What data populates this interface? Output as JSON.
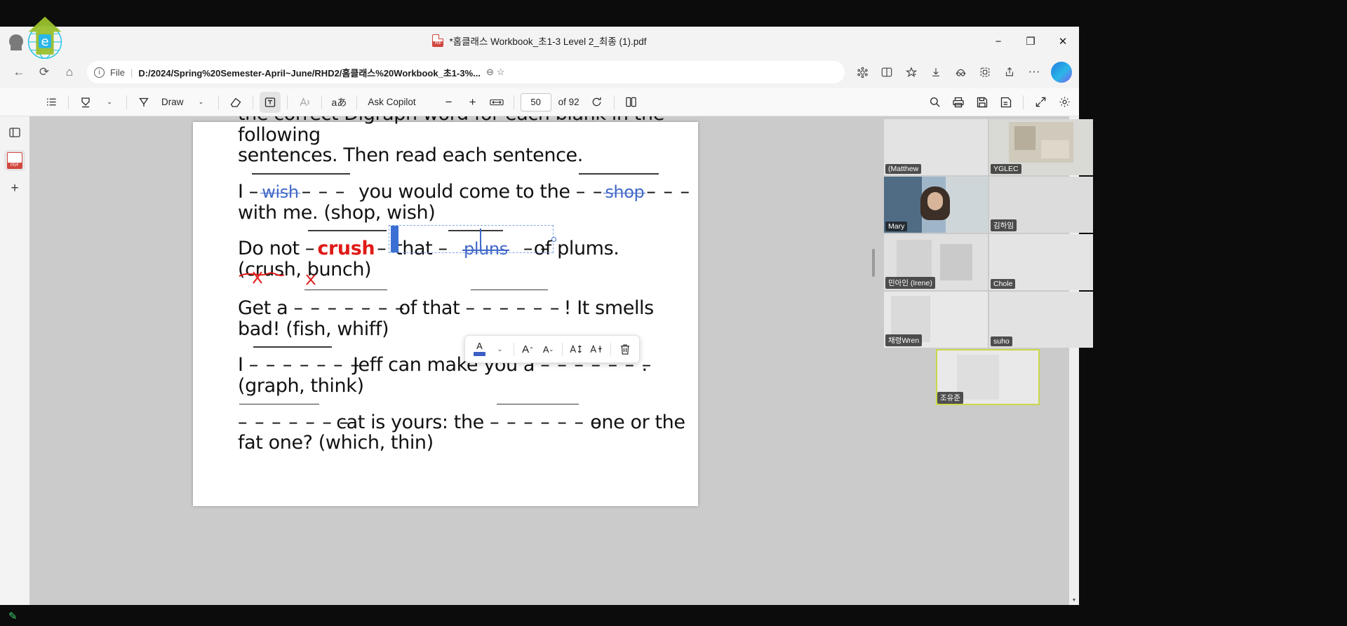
{
  "window": {
    "title": "*홈클래스 Workbook_초1-3 Level 2_최종 (1).pdf",
    "minimize": "−",
    "restore": "❐",
    "close": "✕"
  },
  "navbar": {
    "back": "←",
    "refresh": "⟳",
    "home": "⌂",
    "info_icon": "ⓘ",
    "file_label": "File",
    "separator": "|",
    "url": "D:/2024/Spring%20Semester-April~June/RHD2/홈클래스%20Workbook_초1-3%...",
    "zoom_out_icon": "⊖",
    "favorite_icon": "☆",
    "right_icons": [
      "collections-icon",
      "split-screen-icon",
      "favorites-icon",
      "downloads-icon",
      "extensions-icon",
      "browser-essentials-icon",
      "share-icon",
      "settings-more-icon"
    ],
    "copilot_label": "copilot-icon"
  },
  "pdf_toolbar": {
    "toc_icon": "☰",
    "highlight_icon": "✎",
    "highlight_chevron": "⌄",
    "draw_icon": "▽",
    "draw_label": "Draw",
    "draw_chevron": "⌄",
    "eraser_icon": "◇",
    "text_icon": "T",
    "read_aloud_icon": "A",
    "translate_icon": "aあ",
    "ask_copilot_label": "Ask Copilot",
    "zoom_out": "−",
    "zoom_in": "+",
    "fit_icon": "↔",
    "page_current": "50",
    "page_of": "of 92",
    "rotate_icon": "⟳",
    "layout_icon": "▯",
    "search_icon": "⌕",
    "print_icon": "⎙",
    "save_icon": "💾",
    "save_as_icon": "🖫",
    "fullscreen_icon": "⤢",
    "settings_icon": "⚙"
  },
  "left_rail": {
    "items": [
      {
        "name": "sidebar-toggle-icon",
        "glyph": "▤"
      },
      {
        "name": "pdf-tool-icon",
        "glyph": "PDF"
      },
      {
        "name": "add-icon",
        "glyph": "+"
      }
    ]
  },
  "format_toolbar": {
    "font_color_letter": "A",
    "font_color_hex": "#3b5fc4",
    "font_color_chevron": "⌄",
    "grow_font": "A",
    "shrink_font": "A",
    "line_spacing_increase": "A",
    "line_spacing_decrease": "A",
    "delete_icon": "🗑"
  },
  "document": {
    "intro_line1": "the correct Digraph word for each blank in the following",
    "intro_line2": "sentences. Then read each sentence.",
    "items": [
      {
        "id": "q1",
        "prefix": "I",
        "answer1": "wish",
        "middle": "you would come to the",
        "answer2": "shop",
        "suffix_line": "with me. (shop, wish)"
      },
      {
        "id": "q2",
        "prefix": "Do not",
        "answer1": "crush",
        "middle": "that",
        "answer2": "pluns",
        "suffix": "of plums.",
        "suffix_line": "(crush, bunch)"
      },
      {
        "id": "q3",
        "prefix": "Get a",
        "answer1": "",
        "middle": "of that",
        "answer2": "",
        "suffix": "! It smells",
        "suffix_line": "bad! (fish, whiff)"
      },
      {
        "id": "q4",
        "prefix": "I",
        "answer1": "",
        "middle": "Jeff can make you a",
        "answer2": "",
        "suffix": ".",
        "suffix_line": "(graph, think)"
      },
      {
        "id": "q5",
        "prefix": "",
        "answer1": "",
        "middle": "cat is yours: the",
        "answer2": "",
        "suffix": "one or the",
        "suffix_line": "fat one? (which, thin)"
      }
    ],
    "dashes": "–––––––",
    "dashes_short": "– – –"
  },
  "video_grid": {
    "tiles": [
      {
        "name": "(Matthew",
        "row": 0,
        "col": 0,
        "active": false
      },
      {
        "name": "YGLEC",
        "row": 0,
        "col": 1,
        "active": false
      },
      {
        "name": "Mary",
        "row": 1,
        "col": 0,
        "active": false
      },
      {
        "name": "김하임",
        "row": 1,
        "col": 1,
        "active": false
      },
      {
        "name": "민아인 (Irene)",
        "row": 2,
        "col": 0,
        "active": false
      },
      {
        "name": "Chole",
        "row": 2,
        "col": 1,
        "active": false
      },
      {
        "name": "채령Wren",
        "row": 3,
        "col": 0,
        "active": false
      },
      {
        "name": "suho",
        "row": 3,
        "col": 1,
        "active": false
      },
      {
        "name": "조유준",
        "row": 4,
        "col": 0,
        "active": true
      }
    ]
  },
  "taskbar": {
    "pen_icon": "✎"
  }
}
